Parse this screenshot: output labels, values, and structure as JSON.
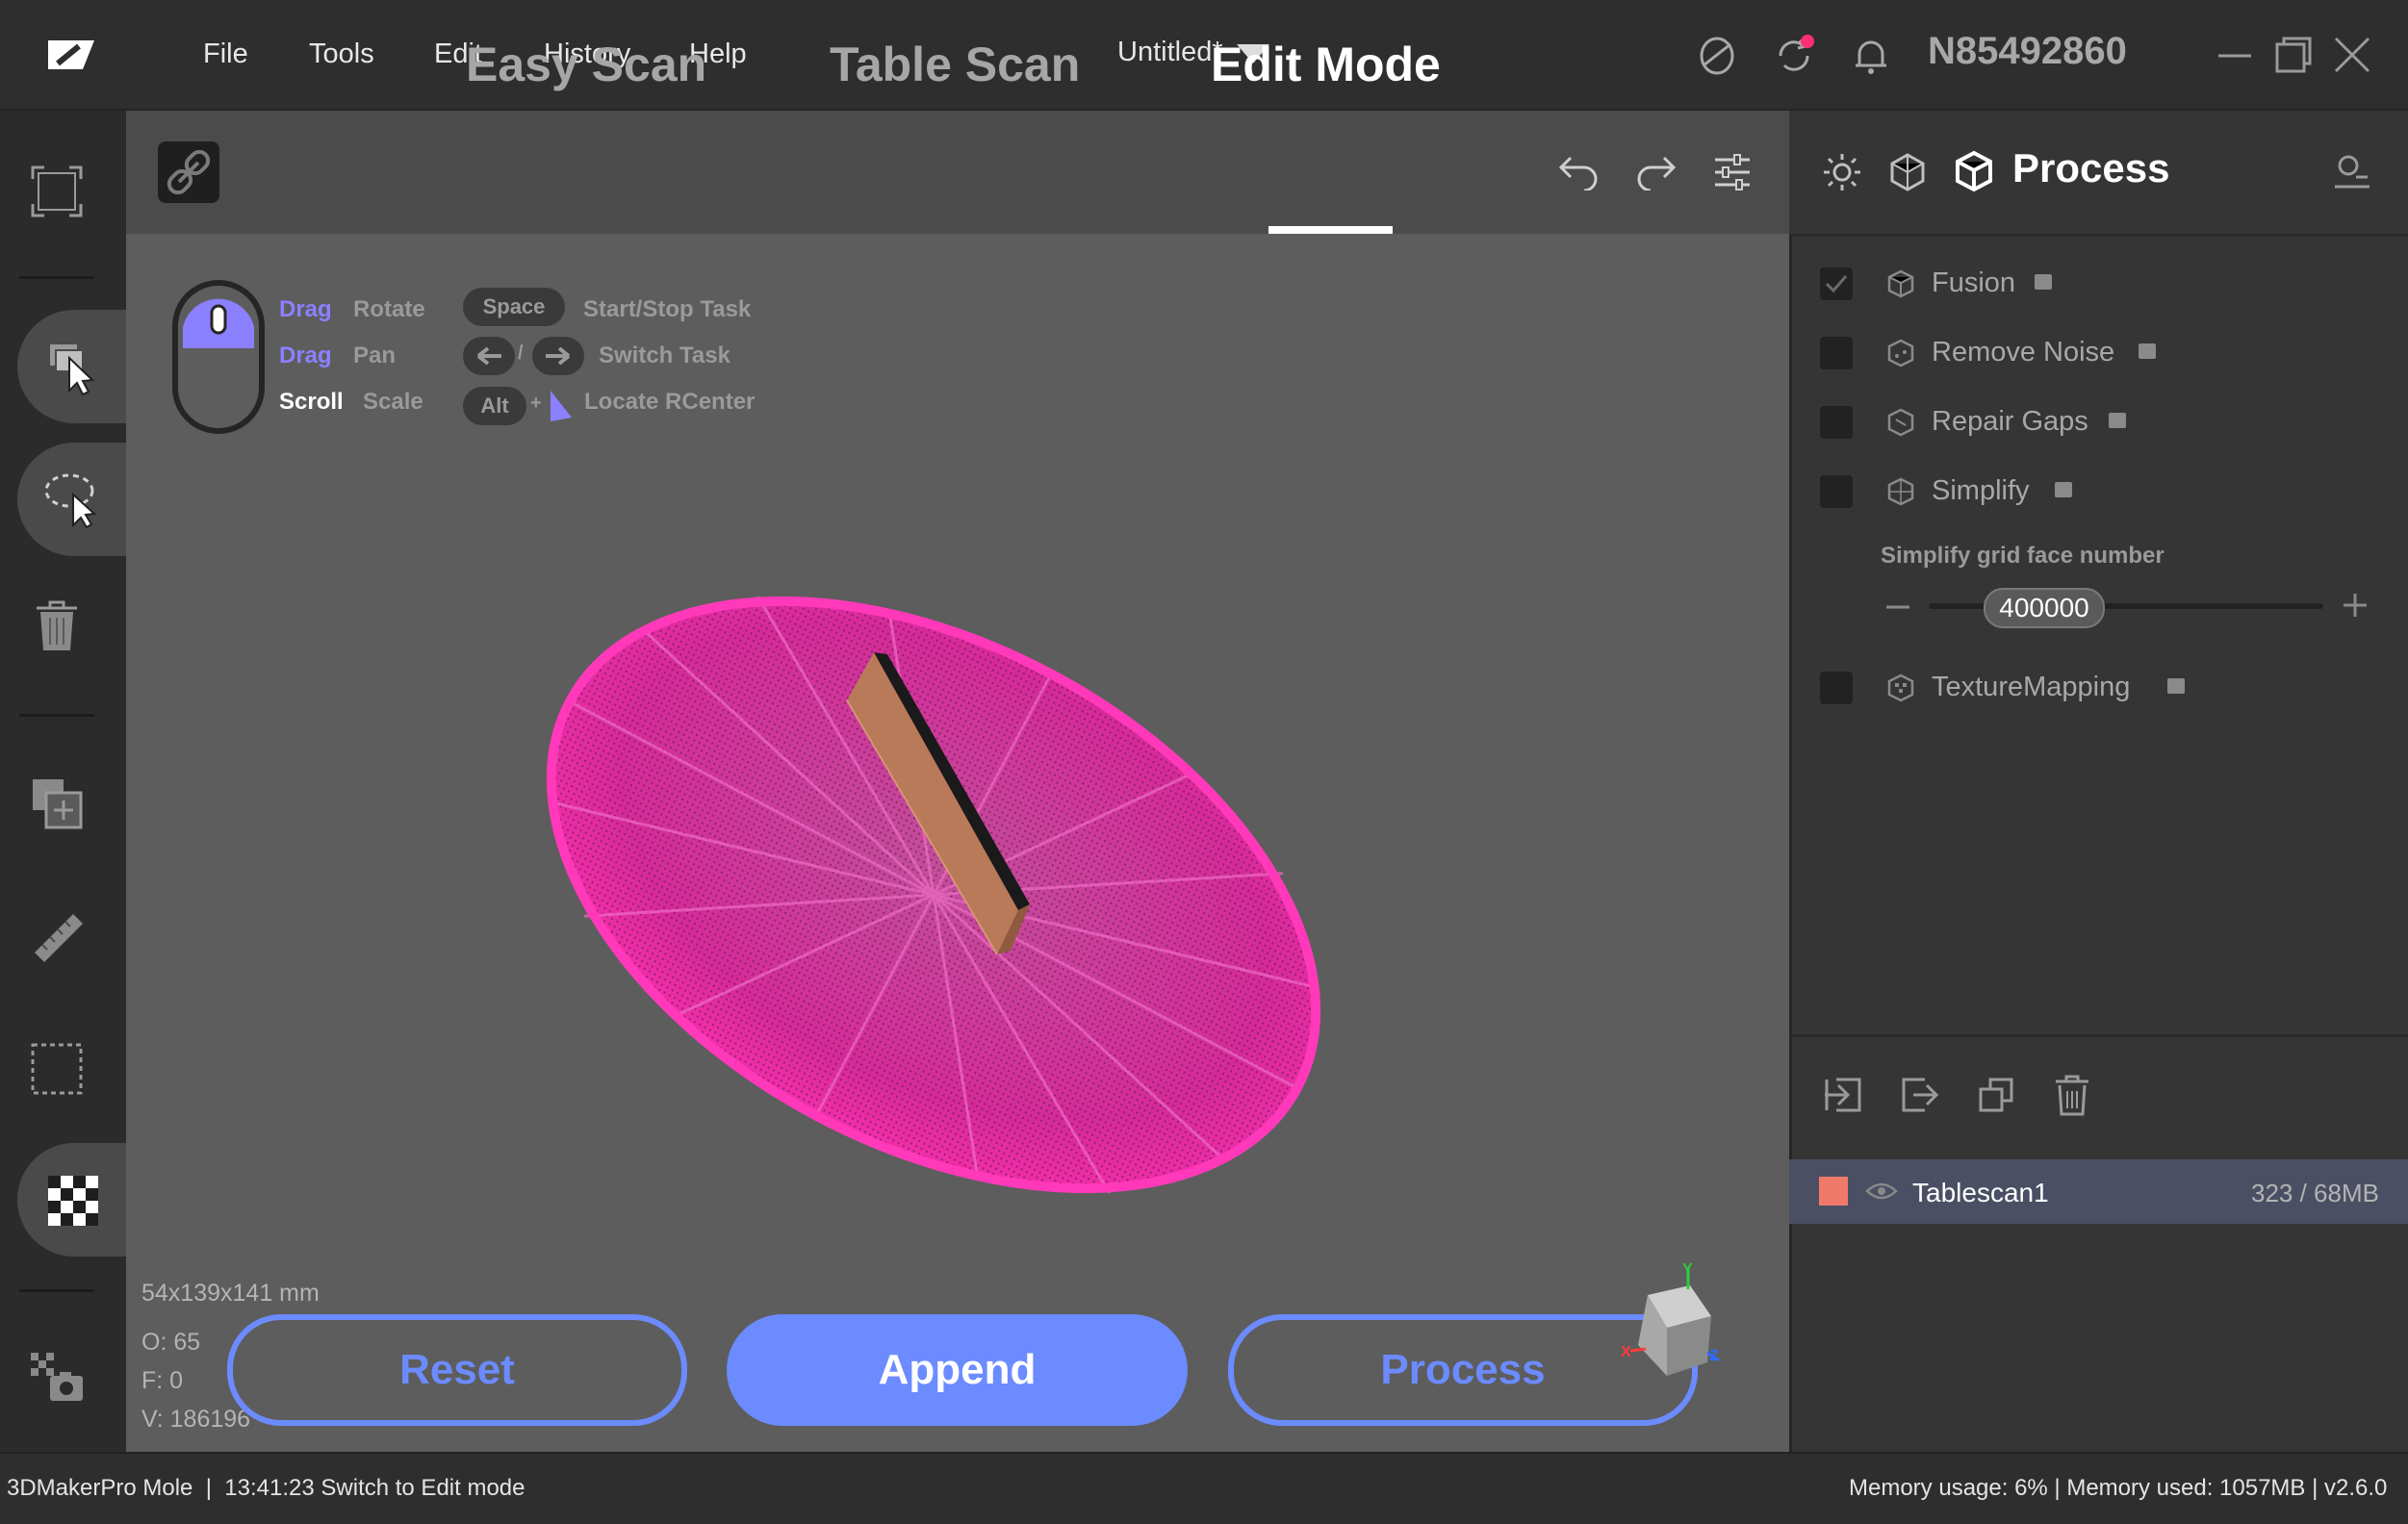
{
  "window": {
    "title": "Untitled*",
    "user_id": "N85492860"
  },
  "menu": [
    "File",
    "Tools",
    "Edit",
    "History",
    "Help"
  ],
  "tabs": {
    "easy_scan": "Easy Scan",
    "table_scan": "Table Scan",
    "edit_mode": "Edit Mode",
    "active": "Edit Mode"
  },
  "hints": {
    "drag1": "Drag",
    "rotate": "Rotate",
    "drag2": "Drag",
    "pan": "Pan",
    "scroll": "Scroll",
    "scale": "Scale",
    "space_key": "Space",
    "start_stop": "Start/Stop Task",
    "switch_task": "Switch Task",
    "alt_key": "Alt",
    "plus": "+",
    "slash": "/",
    "locate": "Locate RCenter"
  },
  "stats": {
    "dimensions": "54x139x141 mm",
    "o": "O: 65",
    "f": "F: 0",
    "v": "V: 186196"
  },
  "actions": {
    "reset": "Reset",
    "append": "Append",
    "process": "Process"
  },
  "axes": {
    "x": "X",
    "y": "Y",
    "z": "Z"
  },
  "process_panel": {
    "title": "Process",
    "steps": [
      {
        "label": "Fusion",
        "checked": true
      },
      {
        "label": "Remove Noise",
        "checked": false
      },
      {
        "label": "Repair Gaps",
        "checked": false
      },
      {
        "label": "Simplify",
        "checked": false
      },
      {
        "label": "TextureMapping",
        "checked": false
      }
    ],
    "simplify_label": "Simplify grid face number",
    "simplify_value": "400000",
    "simplify_level": 0.2
  },
  "layers": [
    {
      "name": "Tablescan1",
      "info": "323 / 68MB",
      "color": "#f07a6a"
    }
  ],
  "status": {
    "left": "3DMakerPro Mole  |  13:41:23 Switch to Edit mode",
    "right": "Memory usage: 6% | Memory used: 1057MB | v2.6.0"
  },
  "colors": {
    "accent": "#6b8bff",
    "scan_pink": "#e0259d",
    "scan_block": "#b97a5a",
    "notification_dot": "#ff2e79"
  }
}
